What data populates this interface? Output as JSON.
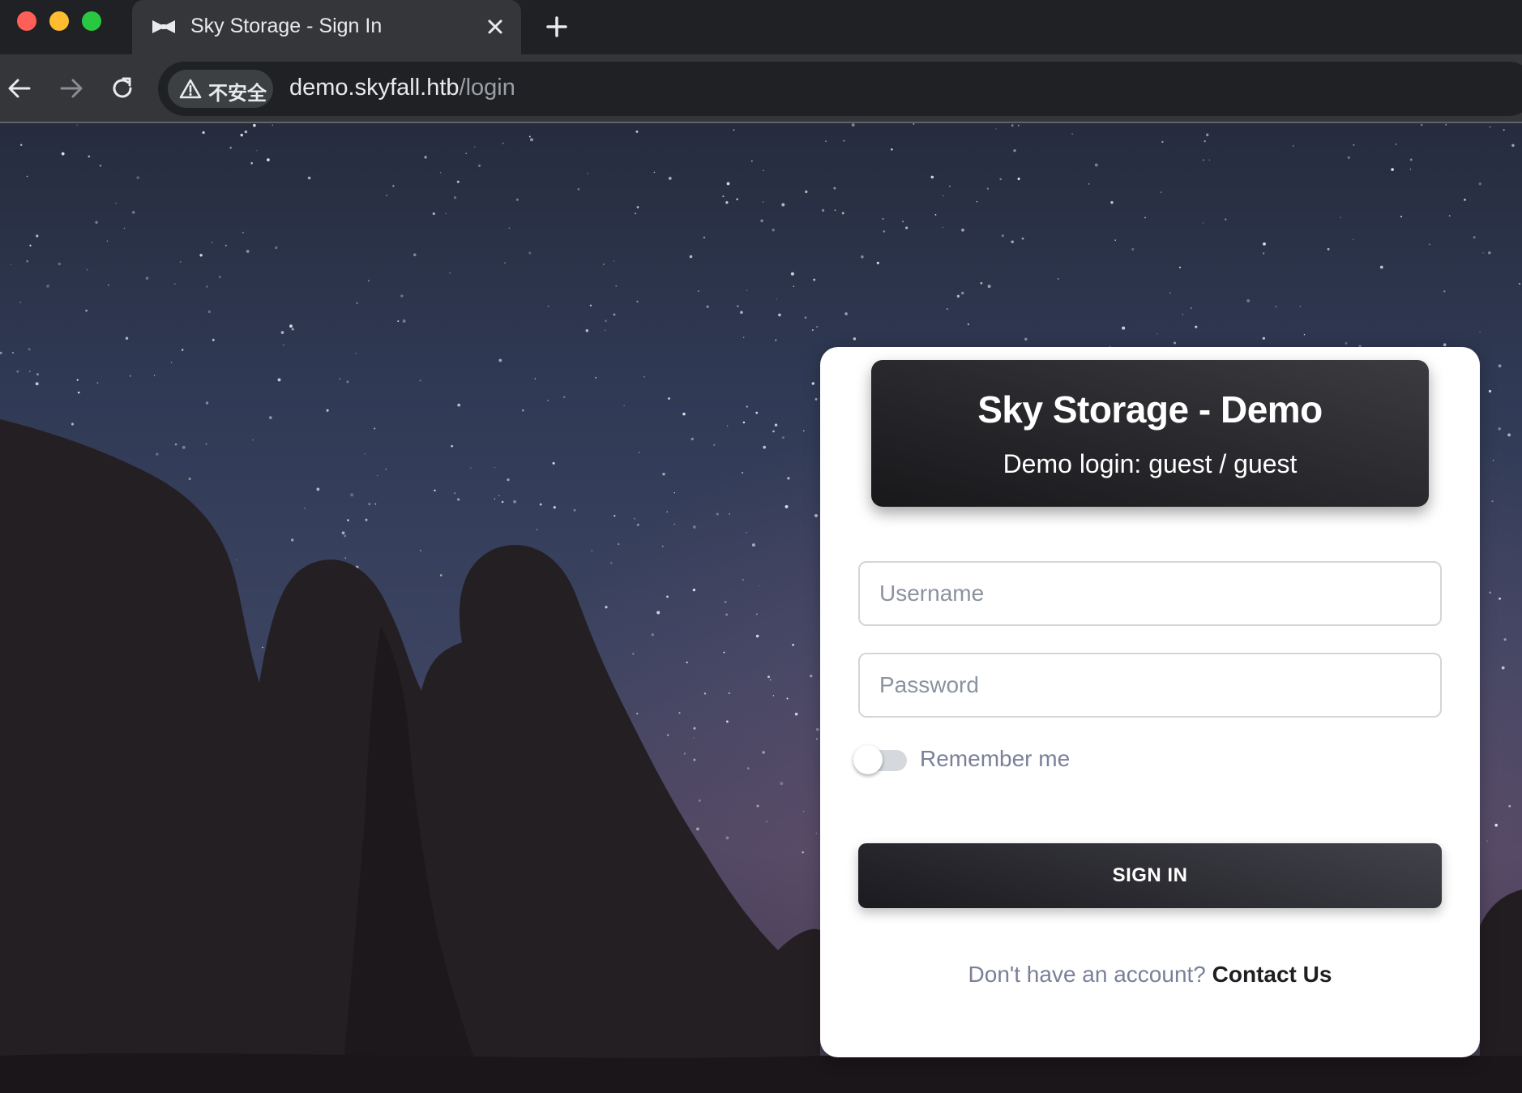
{
  "browser": {
    "tab_title": "Sky Storage - Sign In",
    "security_label": "不安全",
    "url_host": "demo.skyfall.htb",
    "url_path": "/login"
  },
  "login": {
    "title": "Sky Storage - Demo",
    "subtitle": "Demo login: guest / guest",
    "username_placeholder": "Username",
    "username_value": "",
    "password_placeholder": "Password",
    "password_value": "",
    "remember_label": "Remember me",
    "remember_checked": false,
    "signin_label": "SIGN IN",
    "footer_text": "Don't have an account?",
    "contact_label": "Contact Us"
  },
  "colors": {
    "chrome_bg": "#202124",
    "toolbar_bg": "#35363a",
    "card_bg": "#ffffff",
    "header_dark": "#18181b",
    "muted_text": "#7b809a"
  },
  "icons": {
    "favicon": "bowtie-icon",
    "close": "close-icon",
    "new_tab": "plus-icon",
    "back": "arrow-left-icon",
    "forward": "arrow-right-icon",
    "reload": "reload-icon",
    "warning": "warning-triangle-icon"
  }
}
